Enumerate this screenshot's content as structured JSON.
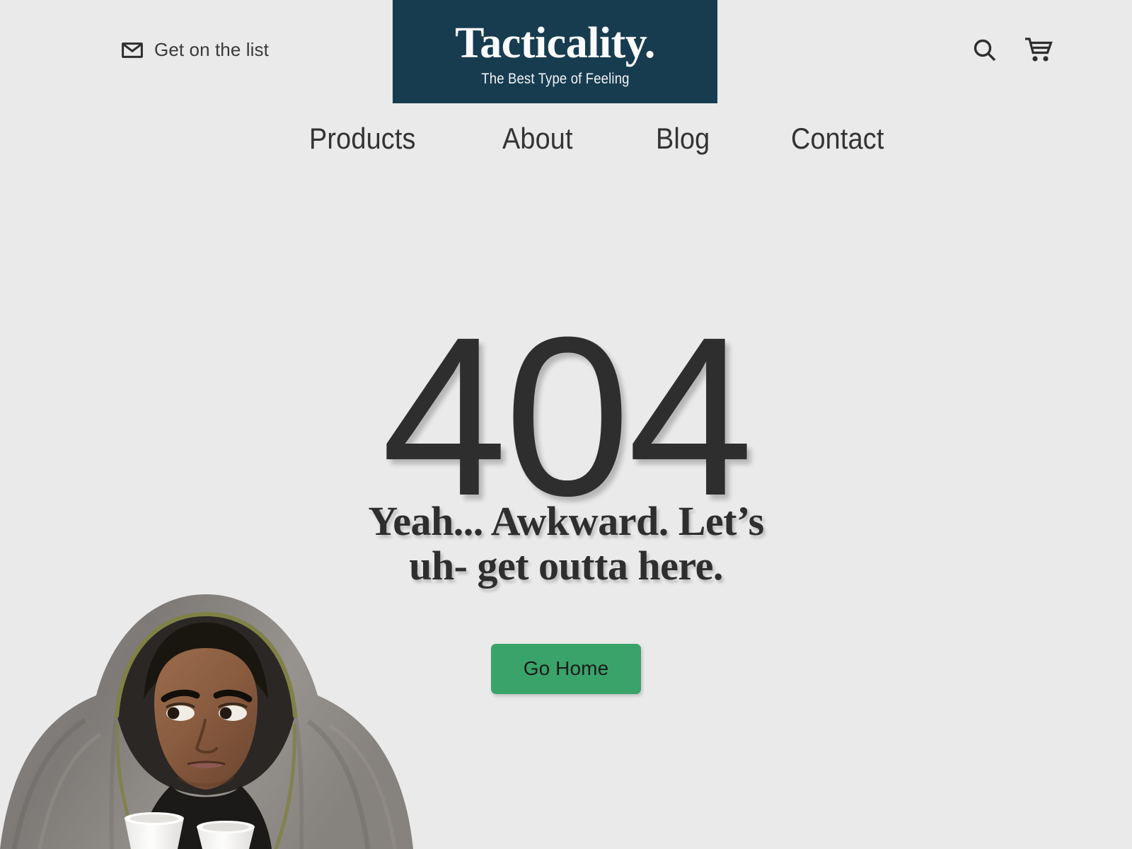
{
  "page": {
    "background_color": "#eaeaea",
    "text_color": "#2e2e2e"
  },
  "header": {
    "mail": {
      "icon": "mail-envelope-icon",
      "label": "Get on the list"
    },
    "logo": {
      "title": "Tacticality.",
      "tagline": "The Best Type of Feeling",
      "background_color": "#173c50",
      "text_color": "#fbfbfb"
    },
    "actions": [
      {
        "icon": "search-icon",
        "label": "Search"
      },
      {
        "icon": "shopping-cart-icon",
        "label": "Cart"
      }
    ]
  },
  "nav": {
    "items": [
      {
        "label": "Products"
      },
      {
        "label": "About"
      },
      {
        "label": "Blog"
      },
      {
        "label": "Contact"
      }
    ]
  },
  "main": {
    "error_code": "404",
    "subtitle_line1": "Yeah... Awkward. Let’s",
    "subtitle_line2": "uh- get outta here.",
    "cta_label": "Go Home",
    "cta_color": "#3aa369"
  },
  "photo": {
    "alt": "Person wrapped in a gray blanket holding two white foam cups, looking to the side"
  }
}
